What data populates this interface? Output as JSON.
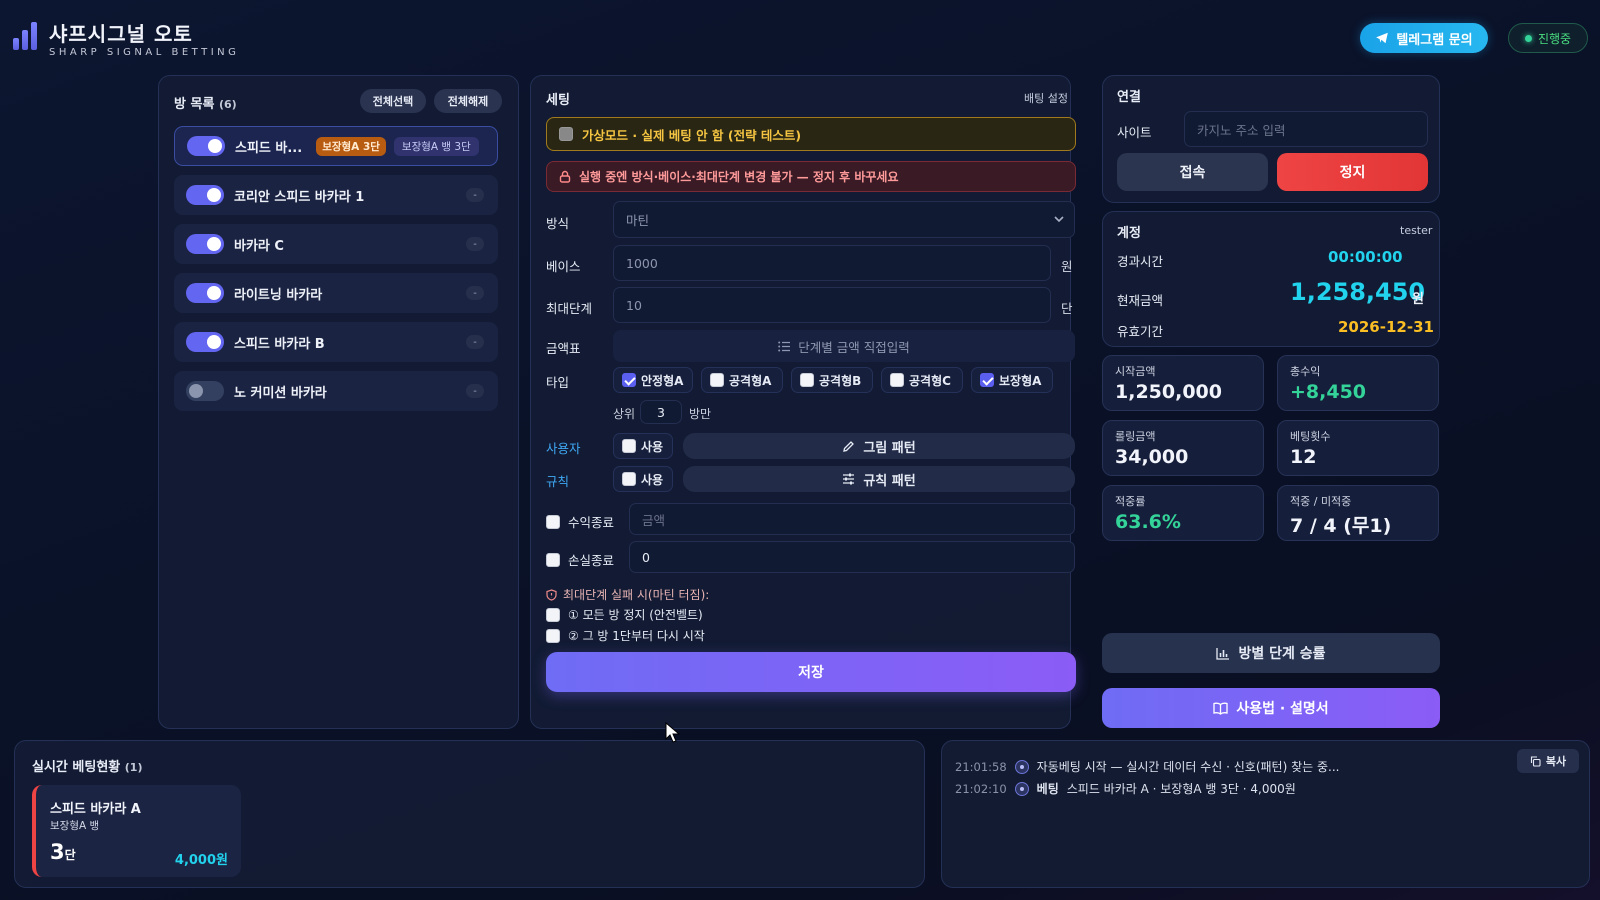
{
  "brand": {
    "title": "샤프시그널 오토",
    "subtitle": "SHARP SIGNAL BETTING"
  },
  "header": {
    "telegram_label": "텔레그램 문의",
    "status_label": "진행중"
  },
  "rooms": {
    "title": "방 목록",
    "count": "(6)",
    "select_all": "전체선택",
    "deselect_all": "전체해제",
    "items": [
      {
        "name": "스피드 바...",
        "on": true,
        "badge1": "보장형A 3단",
        "badge2": "보장형A 뱅 3단"
      },
      {
        "name": "코리안 스피드 바카라 1",
        "on": true,
        "dash": "-"
      },
      {
        "name": "바카라 C",
        "on": true,
        "dash": "-"
      },
      {
        "name": "라이트닝 바카라",
        "on": true,
        "dash": "-"
      },
      {
        "name": "스피드 바카라 B",
        "on": true,
        "dash": "-"
      },
      {
        "name": "노 커미션 바카라",
        "on": false,
        "dash": "-"
      }
    ]
  },
  "settings": {
    "title": "세팅",
    "subtitle": "배팅 설정",
    "virtual_mode": "가상모드 · 실제 베팅 안 함 (전략 테스트)",
    "warning": "실행 중엔 방식·베이스·최대단계 변경 불가 — 정지 후 바꾸세요",
    "method_label": "방식",
    "method_value": "마틴",
    "base_label": "베이스",
    "base_placeholder": "1000",
    "base_unit": "원",
    "max_label": "최대단계",
    "max_placeholder": "10",
    "max_unit": "단",
    "amount_label": "금액표",
    "amount_button": "단계별 금액 직접입력",
    "type_label": "타입",
    "types": [
      {
        "label": "안정형A",
        "checked": true
      },
      {
        "label": "공격형A",
        "checked": false
      },
      {
        "label": "공격형B",
        "checked": false
      },
      {
        "label": "공격형C",
        "checked": false
      },
      {
        "label": "보장형A",
        "checked": true
      }
    ],
    "top_prefix": "상위",
    "top_value": "3",
    "top_suffix": "방만",
    "user_label": "사용자",
    "use_label": "사용",
    "picture_pattern": "그림 패턴",
    "rule_label": "규칙",
    "rule_pattern": "규칙 패턴",
    "profit_stop": "수익종료",
    "profit_placeholder": "금액",
    "loss_stop": "손실종료",
    "loss_value": "0",
    "max_fail_title": "최대단계 실패 시(마틴 터짐):",
    "opt1": "① 모든 방 정지 (안전벨트)",
    "opt2": "② 그 방 1단부터 다시 시작",
    "save": "저장"
  },
  "connection": {
    "title": "연결",
    "site_label": "사이트",
    "site_placeholder": "카지노 주소 입력",
    "connect": "접속",
    "stop": "정지"
  },
  "account": {
    "title": "계정",
    "user": "tester",
    "elapsed_label": "경과시간",
    "elapsed_value": "00:00:00",
    "balance_label": "현재금액",
    "balance_value": "1,258,450",
    "balance_unit": "원",
    "expiry_label": "유효기간",
    "expiry_value": "2026-12-31"
  },
  "stats": [
    {
      "label": "시작금액",
      "value": "1,250,000"
    },
    {
      "label": "총수익",
      "value": "+8,450"
    },
    {
      "label": "롤링금액",
      "value": "34,000"
    },
    {
      "label": "베팅횟수",
      "value": "12"
    },
    {
      "label": "적중률",
      "value": "63.6%"
    },
    {
      "label": "적중 / 미적중",
      "value": "7 / 4 (무1)"
    }
  ],
  "buttons": {
    "room_stats": "방별 단계 승률",
    "manual": "사용법 · 설명서"
  },
  "live": {
    "title": "실시간 베팅현황",
    "count": "(1)",
    "card": {
      "name": "스피드 바카라 A",
      "sub": "보장형A 뱅",
      "step": "3",
      "step_unit": "단",
      "amount": "4,000원"
    }
  },
  "log": {
    "copy": "복사",
    "lines": [
      {
        "time": "21:01:58",
        "bold": "",
        "text": "자동베팅 시작 — 실시간 데이터 수신 · 신호(패턴) 찾는 중..."
      },
      {
        "time": "21:02:10",
        "bold": "베팅",
        "text": "스피드 바카라 A · 보장형A 뱅 3단 · 4,000원"
      }
    ]
  },
  "colors": {
    "accent": "#6366f1",
    "stop": "#ef4444",
    "cyan": "#22d3ee",
    "gold": "#fbbf24",
    "green": "#34d399"
  }
}
